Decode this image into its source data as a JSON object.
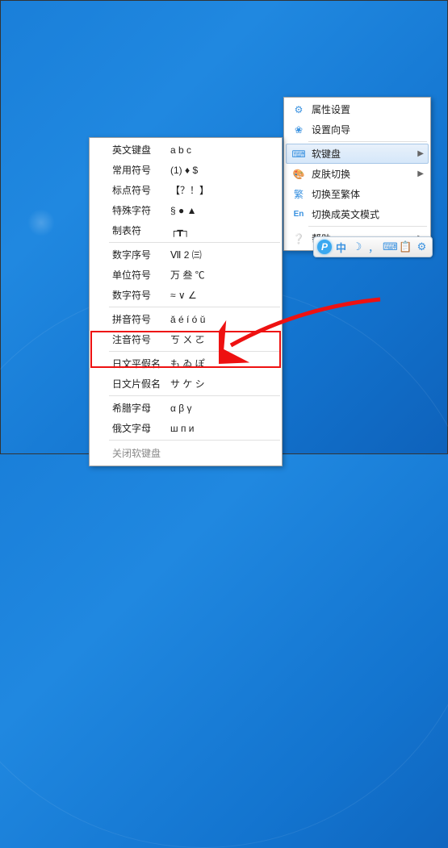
{
  "settings_menu": {
    "items": [
      {
        "icon": "⚙",
        "label": "属性设置",
        "arrow": false
      },
      {
        "icon": "❀",
        "label": "设置向导",
        "arrow": false
      }
    ],
    "group2": [
      {
        "icon": "⌨",
        "label": "软键盘",
        "arrow": true,
        "highlight": true
      },
      {
        "icon": "🎨",
        "label": "皮肤切换",
        "arrow": true
      },
      {
        "icon": "繁",
        "label": "切换至繁体",
        "arrow": false
      },
      {
        "icon": "En",
        "label": "切换成英文模式",
        "arrow": false
      }
    ],
    "group3": [
      {
        "icon": "❔",
        "label": "帮助",
        "arrow": true
      }
    ]
  },
  "sk_menu": {
    "group1": [
      {
        "label": "英文键盘",
        "sample": "a b c"
      },
      {
        "label": "常用符号",
        "sample": "(1) ♦ $"
      },
      {
        "label": "标点符号",
        "sample": "【？！】"
      },
      {
        "label": "特殊字符",
        "sample": "§ ● ▲"
      },
      {
        "label": "制表符",
        "sample": "┌┳┐"
      }
    ],
    "group2": [
      {
        "label": "数字序号",
        "sample": "Ⅶ 2 ㈢"
      },
      {
        "label": "单位符号",
        "sample": "万 叁 ℃"
      },
      {
        "label": "数字符号",
        "sample": "≈ ∨ ∠"
      }
    ],
    "group3": [
      {
        "label": "拼音符号",
        "sample": "ǎ é í ó ǔ"
      },
      {
        "label": "注音符号",
        "sample": "ㄎ ㄨ ㄛ"
      }
    ],
    "group4": [
      {
        "label": "日文平假名",
        "sample": "も ゐ ぽ"
      },
      {
        "label": "日文片假名",
        "sample": "サ ケ シ"
      }
    ],
    "group5": [
      {
        "label": "希腊字母",
        "sample": "α β γ"
      },
      {
        "label": "俄文字母",
        "sample": "ш п и"
      }
    ],
    "close": "关闭软键盘"
  },
  "ime_bar": {
    "logo": "P",
    "items": [
      "中",
      "☽",
      "，",
      "⌨",
      "📋",
      "⚙"
    ]
  }
}
